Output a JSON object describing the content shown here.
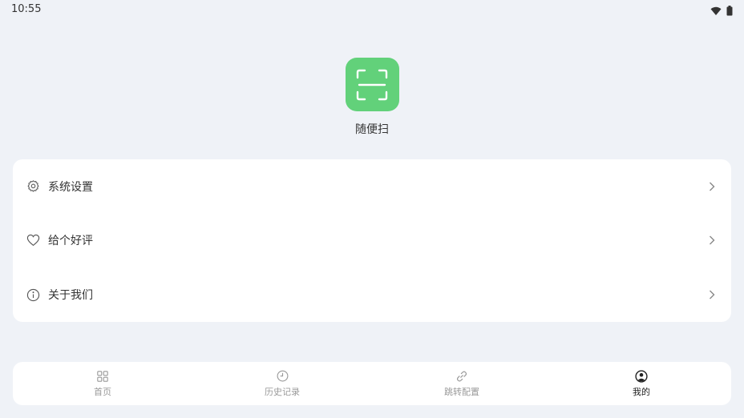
{
  "status_bar": {
    "time": "10:55",
    "icons": [
      "wifi-icon",
      "battery-icon"
    ]
  },
  "app": {
    "name": "随便扫",
    "logo_icon": "scan-icon",
    "accent_color": "#62d17a"
  },
  "menu": {
    "items": [
      {
        "icon": "gear-icon",
        "label": "系统设置"
      },
      {
        "icon": "heart-icon",
        "label": "给个好评"
      },
      {
        "icon": "info-icon",
        "label": "关于我们"
      }
    ]
  },
  "tabs": {
    "items": [
      {
        "icon": "grid-icon",
        "label": "首页",
        "active": false
      },
      {
        "icon": "clock-icon",
        "label": "历史记录",
        "active": false
      },
      {
        "icon": "link-icon",
        "label": "跳转配置",
        "active": false
      },
      {
        "icon": "user-icon",
        "label": "我的",
        "active": true
      }
    ]
  }
}
